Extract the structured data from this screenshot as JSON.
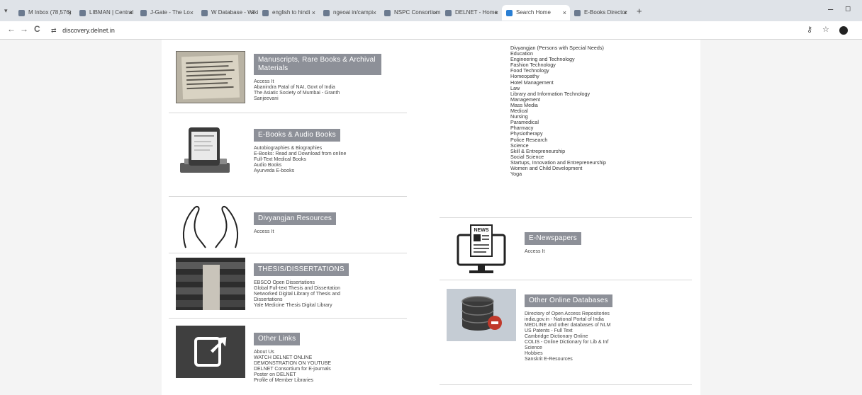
{
  "browser": {
    "tabs": [
      {
        "label": "M  Inbox (78,576)"
      },
      {
        "label": "LIBMAN | Central"
      },
      {
        "label": "J-Gate - The Lo"
      },
      {
        "label": "W  Database - Wiki"
      },
      {
        "label": "english to hindi"
      },
      {
        "label": "ngeoai in/campi"
      },
      {
        "label": "NSPC Consortium"
      },
      {
        "label": "DELNET - Home"
      },
      {
        "label": "Search Home",
        "active": true
      },
      {
        "label": "E-Books Director"
      }
    ],
    "new_tab": "+",
    "minimize": "–",
    "maximize": "◻",
    "back_icon": "←",
    "forward_icon": "→",
    "reload_icon": "C",
    "site_info": "⇄",
    "url": "discovery.delnet.in",
    "key_icon": "⚷",
    "star_icon": "☆"
  },
  "left": {
    "manuscripts": {
      "title": "Manuscripts, Rare Books & Archival Materials",
      "links": [
        "Access It",
        "Abanindra Patal of NAI, Govt of India",
        "The Asiatic Society of Mumbai - Granth",
        "Sanjeevani"
      ]
    },
    "ebooks": {
      "title": "E-Books & Audio Books",
      "links": [
        "Autobiographies & Biographies",
        "E-Books: Read and Download from online",
        "Full-Text Medical Books",
        "Audio Books",
        "Ayurveda E-books"
      ]
    },
    "divyangjan": {
      "title": "Divyangjan Resources",
      "links": [
        "Access It"
      ]
    },
    "thesis": {
      "title": "THESIS/DISSERTATIONS",
      "links": [
        "EBSCO Open Dissertations",
        "Global Full-text Thesis and Dissertation",
        "Networked Digital Library of Thesis and",
        "Dissertations",
        "Yale Medicine Thesis Digital Library"
      ]
    },
    "other_links": {
      "title": "Other Links",
      "links": [
        "About Us",
        "WATCH DELNET ONLINE",
        "DEMONSTRATION ON YOUTUBE",
        "DELNET Consortium for E-journals",
        "Poster on DELNET",
        "Profile of Member Libraries"
      ]
    }
  },
  "right": {
    "subjects": [
      "Divyangjan (Persons with Special Needs)",
      "Education",
      "Engineering and Technology",
      "Fashion Technology",
      "Food Technology",
      "Homeopathy",
      "Hotel Management",
      "Law",
      "Library and Information Technology",
      "Management",
      "Mass Media",
      "Medical",
      "Nursing",
      "Paramedical",
      "Pharmacy",
      "Physiotherapy",
      "Police Research",
      "Science",
      "Skill & Entrepreneurship",
      "Social Science",
      "Startups, Innovation and Entrepreneurship",
      "Women and Child Development",
      "Yoga"
    ],
    "enewspapers": {
      "title": "E-Newspapers",
      "icon_text": "NEWS",
      "links": [
        "Access It"
      ]
    },
    "other_databases": {
      "title": "Other Online Databases",
      "links": [
        "Directory of Open Access Repositories",
        "india.gov.in - National Portal of India",
        "MEDLINE and other databases of NLM",
        "US Patents - Full Text",
        "Cambridge Dictionary Online",
        "COLIS - Online Dictionary for Lib & Inf",
        "Science",
        "Hobbies",
        "Sanskrit E-Resources"
      ]
    }
  }
}
